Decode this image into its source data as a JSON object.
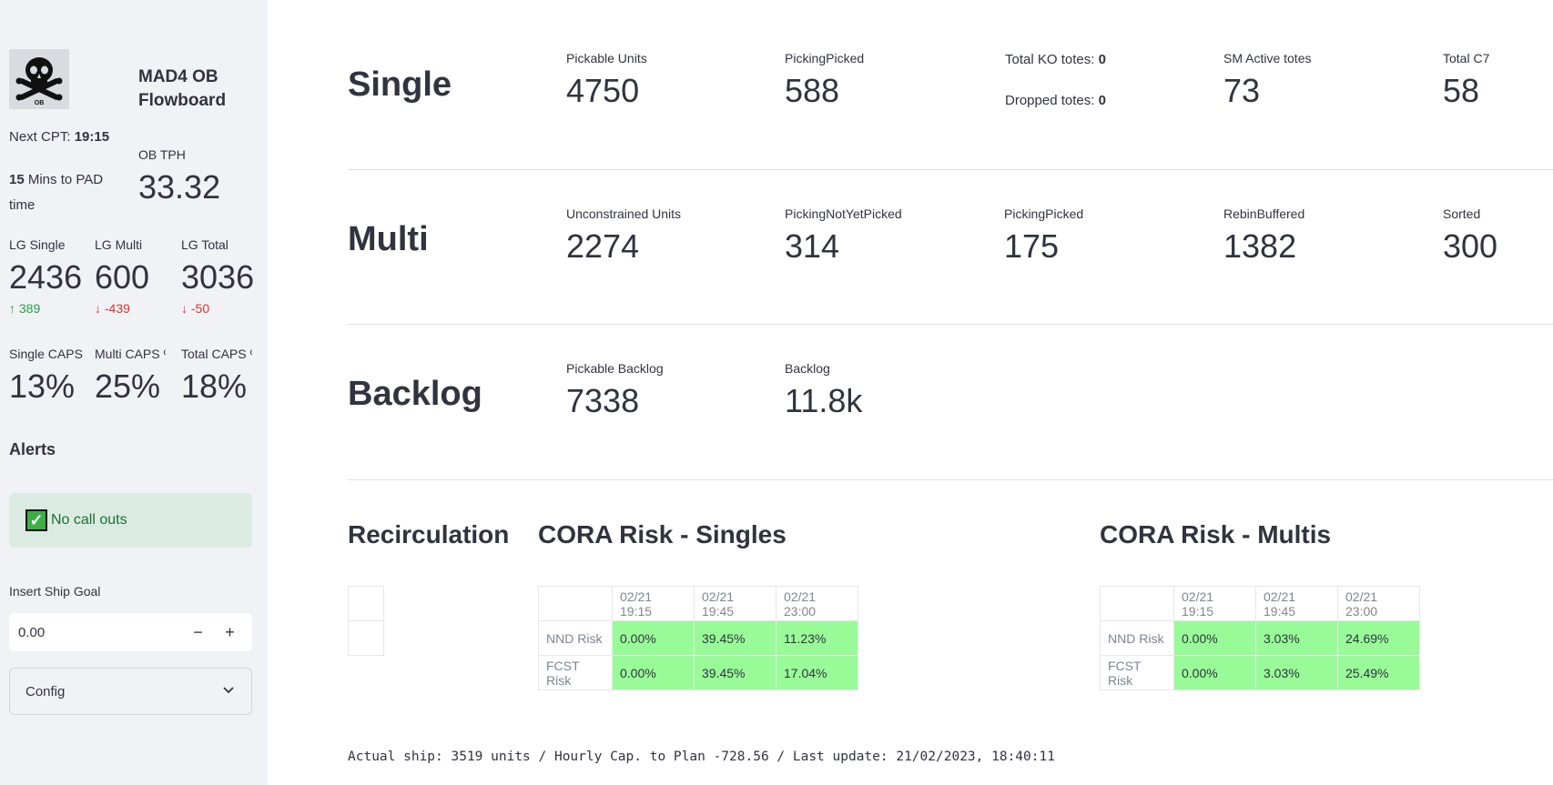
{
  "sidebar": {
    "logo_text": "OB",
    "title": "MAD4 OB Flowboard",
    "next_cpt_label": "Next CPT:",
    "next_cpt_value": "19:15",
    "pad_mins": "15",
    "pad_text": "Mins to PAD time",
    "ob_tph": {
      "label": "OB TPH",
      "value": "33.32"
    },
    "lg_single": {
      "label": "LG Single",
      "value": "2436",
      "delta": "↑ 389"
    },
    "lg_multi": {
      "label": "LG Multi",
      "value": "600",
      "delta": "↓ -439"
    },
    "lg_total": {
      "label": "LG Total",
      "value": "3036",
      "delta": "↓ -50"
    },
    "single_caps": {
      "label": "Single CAPS",
      "value": "13%"
    },
    "multi_caps": {
      "label": "Multi CAPS %",
      "value": "25%"
    },
    "total_caps": {
      "label": "Total CAPS %",
      "value": "18%"
    },
    "alerts_title": "Alerts",
    "alert_text": "No call outs",
    "ship_goal": {
      "label": "Insert Ship Goal",
      "value": "0.00",
      "minus": "−",
      "plus": "+"
    },
    "config_label": "Config"
  },
  "single": {
    "title": "Single",
    "pickable_units": {
      "label": "Pickable Units",
      "value": "4750"
    },
    "picking_picked": {
      "label": "PickingPicked",
      "value": "588"
    },
    "ko_totes": {
      "label": "Total KO totes:",
      "value": "0"
    },
    "dropped_totes": {
      "label": "Dropped totes:",
      "value": "0"
    },
    "sm_active": {
      "label": "SM Active totes",
      "value": "73"
    },
    "total_c7": {
      "label": "Total C7",
      "value": "58"
    }
  },
  "multi": {
    "title": "Multi",
    "unconstrained": {
      "label": "Unconstrained Units",
      "value": "2274"
    },
    "not_yet_picked": {
      "label": "PickingNotYetPicked",
      "value": "314"
    },
    "picking_picked": {
      "label": "PickingPicked",
      "value": "175"
    },
    "rebin_buffered": {
      "label": "RebinBuffered",
      "value": "1382"
    },
    "sorted": {
      "label": "Sorted",
      "value": "300"
    }
  },
  "backlog": {
    "title": "Backlog",
    "pickable_backlog": {
      "label": "Pickable Backlog",
      "value": "7338"
    },
    "backlog": {
      "label": "Backlog",
      "value": "11.8k"
    }
  },
  "recirculation": {
    "title": "Recirculation"
  },
  "cora_singles": {
    "title": "CORA Risk - Singles",
    "columns": [
      "02/21 19:15",
      "02/21 19:45",
      "02/21 23:00"
    ],
    "rows": [
      {
        "name": "NND Risk",
        "values": [
          "0.00%",
          "39.45%",
          "11.23%"
        ]
      },
      {
        "name": "FCST Risk",
        "values": [
          "0.00%",
          "39.45%",
          "17.04%"
        ]
      }
    ]
  },
  "cora_multis": {
    "title": "CORA Risk - Multis",
    "columns": [
      "02/21 19:15",
      "02/21 19:45",
      "02/21 23:00"
    ],
    "rows": [
      {
        "name": "NND Risk",
        "values": [
          "0.00%",
          "3.03%",
          "24.69%"
        ]
      },
      {
        "name": "FCST Risk",
        "values": [
          "0.00%",
          "3.03%",
          "25.49%"
        ]
      }
    ]
  },
  "footer": "Actual ship: 3519 units / Hourly Cap. to Plan -728.56 / Last update: 21/02/2023, 18:40:11",
  "colors": {
    "sidebar_bg": "#f0f2f6",
    "risk_ok": "#98fb98",
    "delta_up": "#21a04a",
    "delta_down": "#e0342b",
    "alert_bg": "#dcebe1"
  }
}
